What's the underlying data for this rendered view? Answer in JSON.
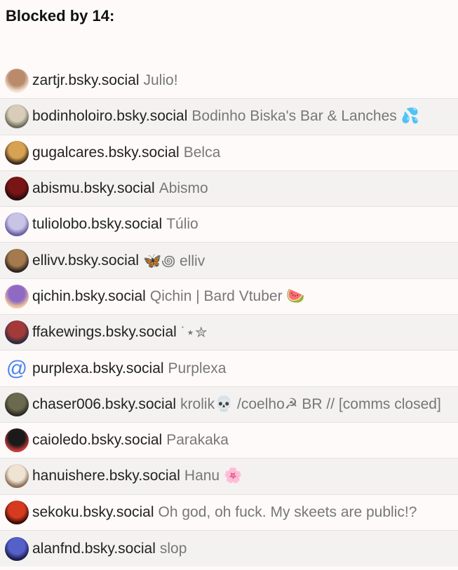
{
  "heading": "Blocked by 14:",
  "accounts": [
    {
      "handle": "zartjr.bsky.social",
      "display": "Julio!",
      "avatar_icon": "avatar-photo",
      "avatar_colors": [
        "#b98a6b",
        "#f1e3d3"
      ]
    },
    {
      "handle": "bodinholoiro.bsky.social",
      "display": "Bodinho Biska's Bar & Lanches 💦",
      "avatar_icon": "avatar-photo",
      "avatar_colors": [
        "#d8cdb8",
        "#6b6b5a"
      ]
    },
    {
      "handle": "gugalcares.bsky.social",
      "display": "Belca",
      "avatar_icon": "avatar-photo",
      "avatar_colors": [
        "#d7a352",
        "#3b2a1b"
      ]
    },
    {
      "handle": "abismu.bsky.social",
      "display": "Abismo",
      "avatar_icon": "avatar-photo",
      "avatar_colors": [
        "#7a1515",
        "#2b0c0c"
      ]
    },
    {
      "handle": "tuliolobo.bsky.social",
      "display": "Túlio",
      "avatar_icon": "avatar-photo",
      "avatar_colors": [
        "#c9c4e6",
        "#6a5fa3"
      ]
    },
    {
      "handle": "ellivv.bsky.social",
      "display": "🦋꩜ elliv",
      "avatar_icon": "avatar-photo",
      "avatar_colors": [
        "#a57b4e",
        "#2d2320"
      ]
    },
    {
      "handle": "qichin.bsky.social",
      "display": "Qichin | Bard Vtuber 🍉",
      "avatar_icon": "avatar-photo",
      "avatar_colors": [
        "#8f6ac4",
        "#f0c89b"
      ]
    },
    {
      "handle": "ffakewings.bsky.social",
      "display": "˙⋆✮",
      "avatar_icon": "avatar-photo",
      "avatar_colors": [
        "#a33a3a",
        "#2c2c3e"
      ]
    },
    {
      "handle": "purplexa.bsky.social",
      "display": "Purplexa",
      "avatar_icon": "at-sign-icon",
      "avatar_glyph": "@",
      "avatar_colors": [
        "#4a86e8",
        "#ffffff"
      ]
    },
    {
      "handle": "chaser006.bsky.social",
      "display": "krolik💀 /coelho☭ BR // [comms closed]",
      "avatar_icon": "avatar-photo",
      "avatar_colors": [
        "#6b6a4f",
        "#2b2b22"
      ]
    },
    {
      "handle": "caioledo.bsky.social",
      "display": "Parakaka",
      "avatar_icon": "avatar-photo",
      "avatar_colors": [
        "#1a1a1a",
        "#c73b3b"
      ]
    },
    {
      "handle": "hanuishere.bsky.social",
      "display": "Hanu 🌸",
      "avatar_icon": "avatar-photo",
      "avatar_colors": [
        "#efe3d4",
        "#8b6f55"
      ]
    },
    {
      "handle": "sekoku.bsky.social",
      "display": "Oh god, oh fuck. My skeets are public!?",
      "avatar_icon": "avatar-photo",
      "avatar_colors": [
        "#d63b1f",
        "#3b0a05"
      ]
    },
    {
      "handle": "alanfnd.bsky.social",
      "display": "slop",
      "avatar_icon": "avatar-photo",
      "avatar_colors": [
        "#5560c8",
        "#1b1d4a"
      ]
    }
  ]
}
